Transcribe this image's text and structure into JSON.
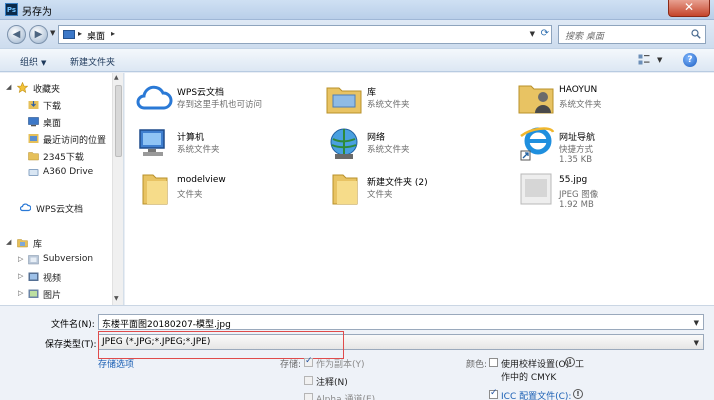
{
  "window": {
    "title": "另存为",
    "app_icon": "Ps",
    "close_glyph": "✕"
  },
  "address": {
    "location": "桌面",
    "search_placeholder": "搜索 桌面"
  },
  "toolbar": {
    "organize": "组织",
    "new_folder": "新建文件夹"
  },
  "nav": {
    "favorites": "收藏夹",
    "items_fav": [
      "下载",
      "桌面",
      "最近访问的位置",
      "2345下载",
      "A360 Drive"
    ],
    "wps": "WPS云文档",
    "library": "库",
    "items_lib": [
      "Subversion",
      "视频",
      "图片"
    ]
  },
  "files": [
    {
      "name": "WPS云文档",
      "meta1": "存到这里手机也可访问",
      "meta2": "",
      "icon": "cloud-icon"
    },
    {
      "name": "库",
      "meta1": "系统文件夹",
      "meta2": "",
      "icon": "library-folder-icon"
    },
    {
      "name": "HAOYUN",
      "meta1": "系统文件夹",
      "meta2": "",
      "icon": "user-folder-icon"
    },
    {
      "name": "计算机",
      "meta1": "系统文件夹",
      "meta2": "",
      "icon": "computer-icon"
    },
    {
      "name": "网络",
      "meta1": "系统文件夹",
      "meta2": "",
      "icon": "network-icon"
    },
    {
      "name": "网址导航",
      "meta1": "快捷方式",
      "meta2": "1.35 KB",
      "icon": "ie-shortcut-icon"
    },
    {
      "name": "modelview",
      "meta1": "文件夹",
      "meta2": "",
      "icon": "folder-icon"
    },
    {
      "name": "新建文件夹 (2)",
      "meta1": "文件夹",
      "meta2": "",
      "icon": "folder-icon"
    },
    {
      "name": "55.jpg",
      "meta1": "JPEG 图像",
      "meta2": "1.92 MB",
      "icon": "jpeg-thumbnail-icon"
    }
  ],
  "form": {
    "filename_label": "文件名(N):",
    "filename_value": "东楼平面图20180207-模型.jpg",
    "type_label": "保存类型(T):",
    "type_value": "JPEG (*.JPG;*.JPEG;*.JPE)",
    "save_options_link": "存储选项",
    "store_label": "存储:",
    "as_copy": "作为副本(Y)",
    "notes": "注释(N)",
    "alpha": "Alpha 通道(E)",
    "color_label": "颜色:",
    "proof_setup": "使用校样设置(O): 工",
    "proof_setup2": "作中的 CMYK",
    "icc": "ICC 配置文件(C):"
  },
  "colors": {
    "accent": "#1a5fb4",
    "highlight_box": "#e04b4b"
  }
}
